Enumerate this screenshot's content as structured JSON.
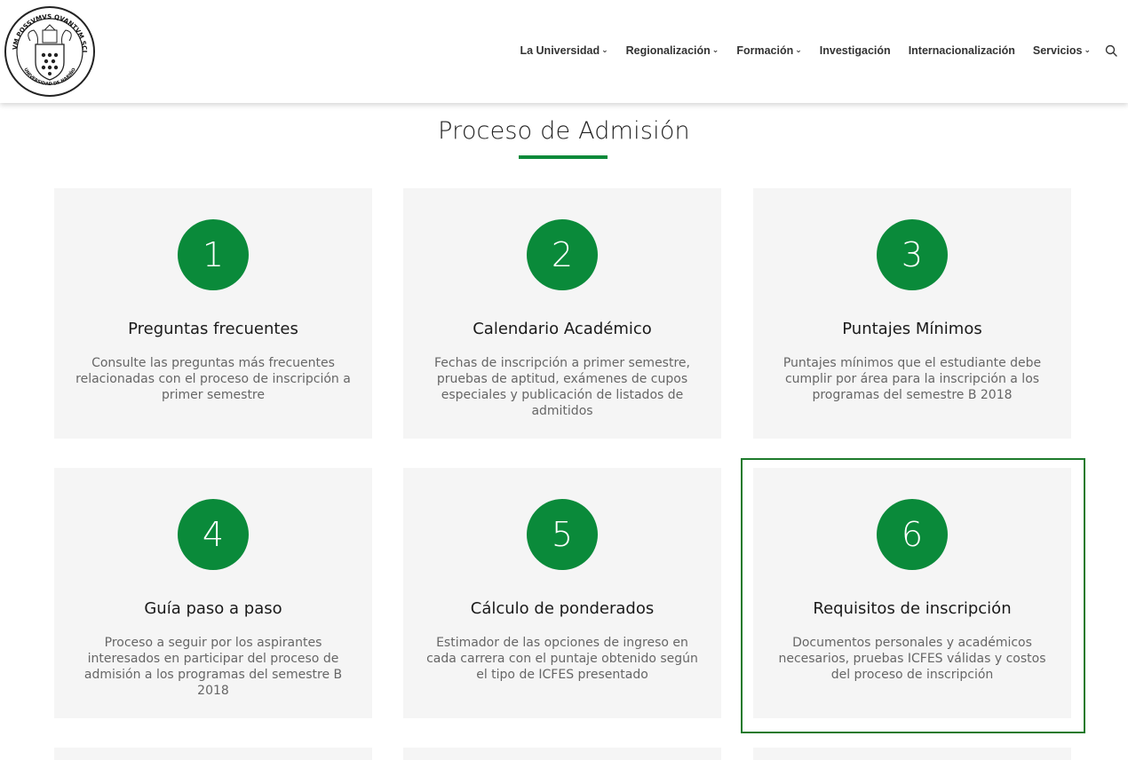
{
  "header": {
    "logo_alt": "Universidad de Nariño",
    "logo_text_top": "TANTVM POSSVMVS QVANTVM SCIMVS",
    "logo_text_bottom": "UNIVERSIDAD DE NARIÑO",
    "nav": [
      {
        "label": "La Universidad",
        "has_dropdown": true
      },
      {
        "label": "Regionalización",
        "has_dropdown": true
      },
      {
        "label": "Formación",
        "has_dropdown": true
      },
      {
        "label": "Investigación",
        "has_dropdown": false
      },
      {
        "label": "Internacionalización",
        "has_dropdown": false
      },
      {
        "label": "Servicios",
        "has_dropdown": true
      }
    ],
    "search_icon": "search-icon"
  },
  "page": {
    "title": "Proceso de Admisión",
    "accent_color": "#0a8a3a"
  },
  "cards": [
    {
      "number": "1",
      "title": "Preguntas frecuentes",
      "description": "Consulte las preguntas más frecuentes relacionadas con el proceso de inscripción a primer semestre"
    },
    {
      "number": "2",
      "title": "Calendario Académico",
      "description": "Fechas de inscripción a primer semestre, pruebas de aptitud, exámenes de cupos especiales y publicación de listados de admitidos"
    },
    {
      "number": "3",
      "title": "Puntajes Mínimos",
      "description": "Puntajes mínimos que el estudiante debe cumplir por área para la inscripción a los programas del semestre B 2018"
    },
    {
      "number": "4",
      "title": "Guía paso a paso",
      "description": "Proceso a seguir por los aspirantes interesados en participar del proceso de admisión a los programas del semestre B 2018"
    },
    {
      "number": "5",
      "title": "Cálculo de ponderados",
      "description": "Estimador de las opciones de ingreso en cada carrera con el puntaje obtenido según el tipo de ICFES presentado"
    },
    {
      "number": "6",
      "title": "Requisitos de inscripción",
      "description": "Documentos personales y académicos necesarios, pruebas ICFES válidas y costos del proceso de inscripción"
    }
  ]
}
